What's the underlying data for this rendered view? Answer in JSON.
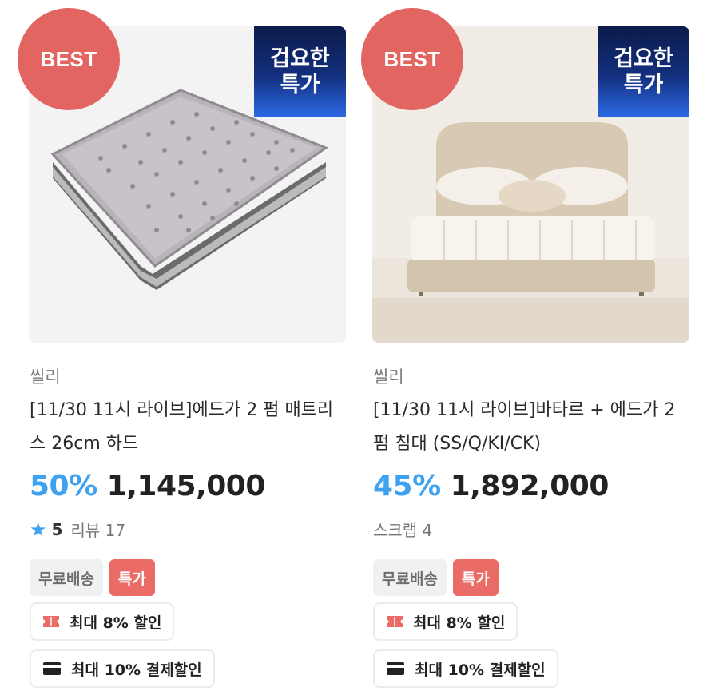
{
  "products": [
    {
      "best_badge": "BEST",
      "sale_badge_line1": "겁요한",
      "sale_badge_line2": "특가",
      "brand": "씰리",
      "title": "[11/30 11시 라이브]에드가 2 펌 매트리스 26cm 하드",
      "discount": "50%",
      "price": "1,145,000",
      "rating": "5",
      "review_text": "리뷰 17",
      "tags": [
        "무료배송",
        "특가"
      ],
      "coupons": [
        "최대 8% 할인",
        "최대 10% 결제할인"
      ],
      "icons": [
        "star-icon",
        "coupon-icon",
        "card-icon"
      ]
    },
    {
      "best_badge": "BEST",
      "sale_badge_line1": "겁요한",
      "sale_badge_line2": "특가",
      "brand": "씰리",
      "title": "[11/30 11시 라이브]바타르 + 에드가 2 펌 침대 (SS/Q/KI/CK)",
      "discount": "45%",
      "price": "1,892,000",
      "scrap_text": "스크랩 4",
      "tags": [
        "무료배송",
        "특가"
      ],
      "coupons": [
        "최대 8% 할인",
        "최대 10% 결제할인"
      ],
      "icons": [
        "coupon-icon",
        "card-icon"
      ]
    }
  ],
  "colors": {
    "best_badge": "#e36561",
    "discount": "#3ea2f0",
    "special_tag": "#eb6b66",
    "sale_badge_top": "#0b1a4a",
    "sale_badge_bottom": "#2c6ae6"
  }
}
